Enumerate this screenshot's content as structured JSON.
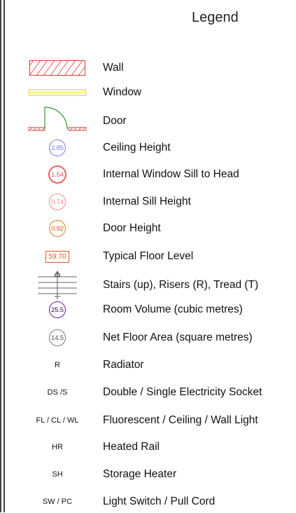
{
  "title": "Legend",
  "colors": {
    "wall": "#e03a3a",
    "window": "#e8e000",
    "door_arc": "#2a9a2a",
    "ceiling_height": "#7a78e8",
    "window_sill_head": "#e85a5a",
    "sill_height": "#f08a8a",
    "door_height": "#e07a1a",
    "floor_level": "#e05a2b",
    "room_volume": "#6a1a9a",
    "net_floor_area": "#777777"
  },
  "items": [
    {
      "symbol": "wall-hatch",
      "label": "Wall"
    },
    {
      "symbol": "window-bar",
      "label": "Window"
    },
    {
      "symbol": "door-swing",
      "label": "Door"
    },
    {
      "symbol": "circle",
      "value": "2.85",
      "label": "Ceiling Height"
    },
    {
      "symbol": "circle",
      "value": "1.54",
      "label": "Internal Window Sill to Head"
    },
    {
      "symbol": "circle",
      "value": "0.74",
      "label": "Internal Sill Height"
    },
    {
      "symbol": "circle",
      "value": "0.92",
      "label": "Door Height"
    },
    {
      "symbol": "box",
      "value": "59.70",
      "label": "Typical Floor Level"
    },
    {
      "symbol": "stairs",
      "label": "Stairs (up), Risers (R), Tread (T)"
    },
    {
      "symbol": "circle",
      "value": "25.5",
      "label": "Room Volume (cubic metres)"
    },
    {
      "symbol": "circle",
      "value": "14.5",
      "label": "Net Floor Area (square metres)"
    },
    {
      "symbol": "code",
      "value": "R",
      "label": "Radiator"
    },
    {
      "symbol": "code",
      "value": "DS /S",
      "label": "Double / Single Electricity Socket"
    },
    {
      "symbol": "code",
      "value": "FL / CL / WL",
      "label": "Fluorescent / Ceiling / Wall Light"
    },
    {
      "symbol": "code",
      "value": "HR",
      "label": "Heated Rail"
    },
    {
      "symbol": "code",
      "value": "SH",
      "label": "Storage Heater"
    },
    {
      "symbol": "code",
      "value": "SW / PC",
      "label": "Light Switch / Pull Cord"
    }
  ]
}
